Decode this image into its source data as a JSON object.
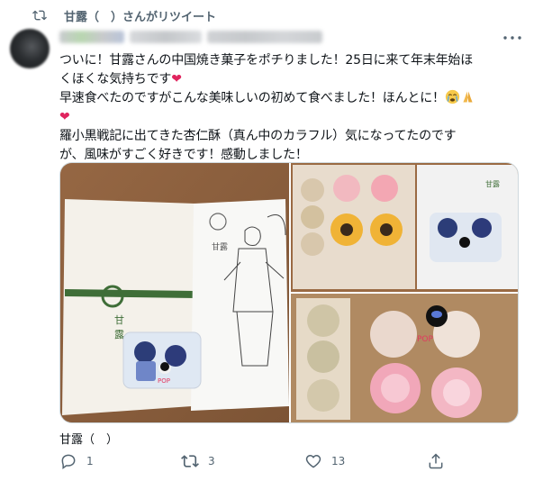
{
  "retweet": {
    "label": "甘露（　）さんがリツイート"
  },
  "tweet": {
    "text_lines": [
      "ついに！甘露さんの中国焼き菓子をポチりました！25日に来て年末年始ほくほくな気持ちです",
      "早速食べたのですがこんな美味しいの初めて食べました！ほんとに！",
      "羅小黒戦記に出てきた杏仁酥（真ん中のカラフル）気になってたのですが、風味がすごく好きです！感動しました！"
    ],
    "display_lines": [
      "ついに！甘露さんの中国焼き菓子をポチりました！25日に来て年末年始ほ",
      "くほくな気持ちです",
      "早速食べたのですがこんな美味しいの初めて食べました！ほんとに！",
      "羅小黒戦記に出てきた杏仁酥（真ん中のカラフル）気になってたのです",
      "が、風味がすごく好きです！感動しました！"
    ],
    "quoted_author": "甘露（　）"
  },
  "actions": {
    "reply_count": "1",
    "retweet_count": "3",
    "like_count": "13"
  },
  "icons": [
    "retweet-icon",
    "more-icon",
    "reply-icon",
    "like-icon",
    "share-icon",
    "heart-emoji",
    "crying-face-emoji",
    "folded-hands-emoji"
  ],
  "colors": {
    "accent_heart": "#e0245e",
    "muted_text": "#536471",
    "text": "#0f1419"
  }
}
